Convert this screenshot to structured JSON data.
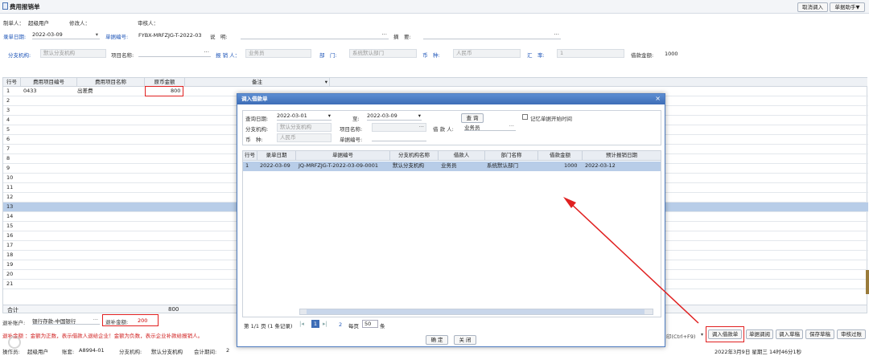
{
  "window": {
    "title": "费用报销单",
    "btn_cancel_import": "取消调入",
    "btn_assistant": "单据助手▼"
  },
  "header": {
    "maker_label": "制单人：",
    "maker_value": "超级用户",
    "editor_label": "修改人：",
    "reviewer_label": "审核人：",
    "entry_date_label": "录单日期:",
    "entry_date": "2022-03-09",
    "doc_no_label": "单据编号:",
    "doc_no": "FYBX-MRFZJG-T-2022-03",
    "desc_label": "说　明:",
    "summary_label": "摘　要:",
    "branch_label": "分支机构:",
    "branch_value": "默认分支机构",
    "project_label": "项目名称:",
    "reporter_label": "报 销 人：",
    "reporter_value": "业务员",
    "dept_label": "部　门:",
    "dept_value": "系统默认部门",
    "currency_label": "币　种:",
    "currency_value": "人民币",
    "rate_label": "汇　率:",
    "rate_value": "1",
    "loan_label": "借款金额:",
    "loan_value": "1000"
  },
  "grid": {
    "headers": [
      "行号",
      "费用项目编号",
      "费用项目名称",
      "原币金额",
      "备注"
    ],
    "rows": [
      {
        "n": "1",
        "code": "0433",
        "name": "出差费",
        "amount": "800"
      },
      {
        "n": "2"
      },
      {
        "n": "3"
      },
      {
        "n": "4"
      },
      {
        "n": "5"
      },
      {
        "n": "6"
      },
      {
        "n": "7"
      },
      {
        "n": "8"
      },
      {
        "n": "9"
      },
      {
        "n": "10"
      },
      {
        "n": "11"
      },
      {
        "n": "12"
      },
      {
        "n": "13"
      },
      {
        "n": "14"
      },
      {
        "n": "15"
      },
      {
        "n": "16"
      },
      {
        "n": "17"
      },
      {
        "n": "18"
      },
      {
        "n": "19"
      },
      {
        "n": "20"
      },
      {
        "n": "21"
      }
    ],
    "total_label": "合计",
    "total_value": "800"
  },
  "footer": {
    "refund_account_label": "退补账户:",
    "refund_account": "银行存款-中国银行",
    "refund_amount_label": "退补金额:",
    "refund_amount": "200",
    "note": "退补金额 ：金额为正数，表示借款人退给企业！金额为负数，表示企业补款给报销人。",
    "operator_label": "操作员:",
    "operator": "超级用户",
    "ledger_label": "账套:",
    "ledger": "A8994-01",
    "branch_label": "分支机构:",
    "branch": "默认分支机构",
    "period_label": "会计期间:",
    "period": "2",
    "datetime": "2022年3月9日 星期三 14时46分1秒",
    "print_hint": "印(Ctrl+F9)",
    "buttons": [
      "调入借款单",
      "单据调阅",
      "调入草稿",
      "保存草稿",
      "审核过账"
    ]
  },
  "dialog": {
    "title": "调入借款单",
    "query_date_label": "查询日期:",
    "date_from": "2022-03-01",
    "to_label": "至:",
    "date_to": "2022-03-09",
    "query_btn": "查 询",
    "remember_label": "记忆单据开始时间",
    "branch_label": "分支机构:",
    "branch_placeholder": "默认分支机构",
    "project_label": "项目名称:",
    "borrower_label": "借 款 人:",
    "borrower_value": "业务员",
    "currency_label": "币　种:",
    "currency_placeholder": "人民币",
    "doc_no_label": "单据编号:",
    "headers": [
      "行号",
      "录单日期",
      "单据编号",
      "分支机构名称",
      "借款人",
      "部门名称",
      "借款金额",
      "预计报销日期"
    ],
    "rows": [
      {
        "n": "1",
        "date": "2022-03-09",
        "no": "JQ-MRFZJG-T-2022-03-09-0001",
        "branch": "默认分支机构",
        "person": "业务员",
        "dept": "系统默认部门",
        "amount": "1000",
        "due": "2022-03-12"
      }
    ],
    "pager": {
      "page_text": "第 1/1 页 (1 条记录)",
      "current": "1",
      "next": "2",
      "per_page_label": "每页",
      "per_page": "50",
      "unit": "条"
    },
    "ok_btn": "确 定",
    "close_btn": "关 闭"
  },
  "colors": {
    "accent": "#3d6db7",
    "red": "#e02020",
    "selected": "#b8cde8"
  }
}
